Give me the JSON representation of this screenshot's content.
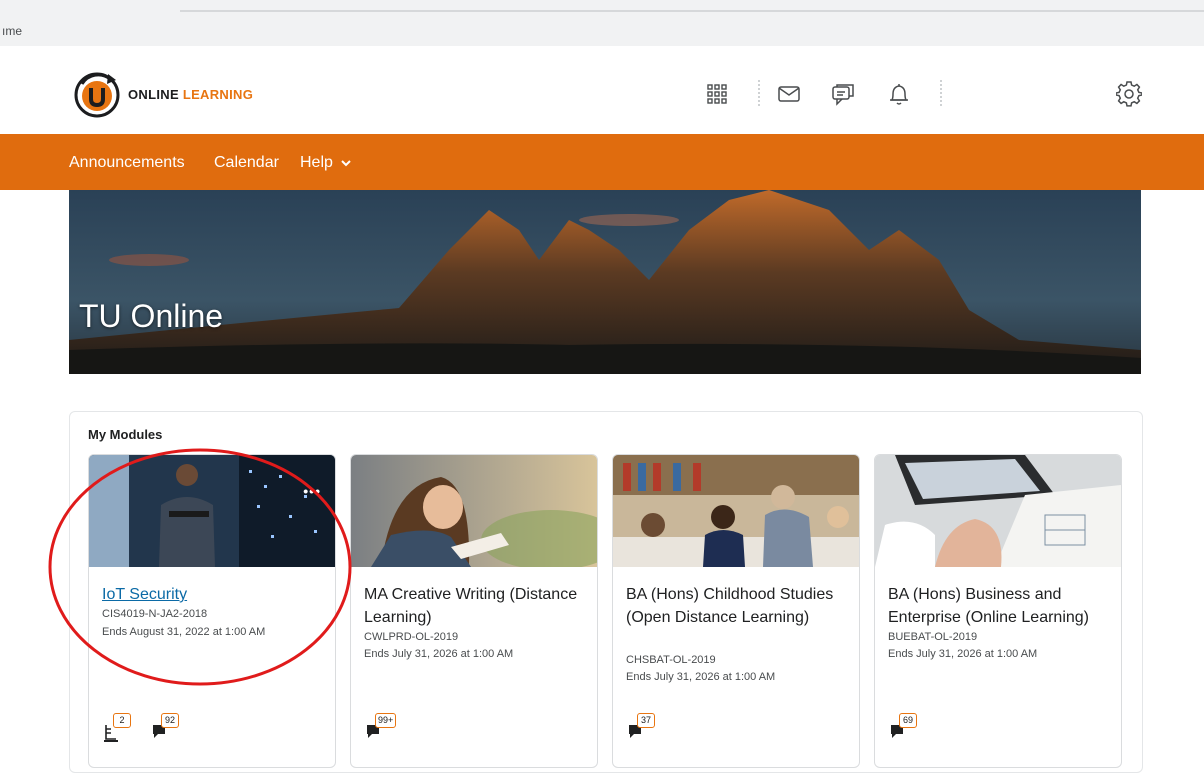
{
  "browser": {
    "partial_tab_text": "ıme"
  },
  "header": {
    "brand_part1": "ONLINE",
    "brand_part2": "LEARNING",
    "icons": [
      "apps-grid-icon",
      "mail-icon",
      "chat-icon",
      "bell-icon",
      "gear-icon"
    ]
  },
  "nav": {
    "items": [
      "Announcements",
      "Calendar",
      "Help"
    ]
  },
  "hero": {
    "title": "TU Online"
  },
  "modules": {
    "title": "My Modules",
    "cards": [
      {
        "title": "IoT Security",
        "code": "CIS4019-N-JA2-2018",
        "ends": "Ends August 31, 2022 at 1:00 AM",
        "badges": [
          "2",
          "92"
        ]
      },
      {
        "title": "MA Creative Writing (Distance Learning)",
        "code": "CWLPRD-OL-2019",
        "ends": "Ends July 31, 2026 at 1:00 AM",
        "badges": [
          "99+"
        ]
      },
      {
        "title": "BA (Hons) Childhood Studies (Open Distance Learning)",
        "code": "CHSBAT-OL-2019",
        "ends": "Ends July 31, 2026 at 1:00 AM",
        "badges": [
          "37"
        ]
      },
      {
        "title": "BA (Hons) Business and Enterprise (Online Learning)",
        "code": "BUEBAT-OL-2019",
        "ends": "Ends July 31, 2026 at 1:00 AM",
        "badges": [
          "69"
        ]
      }
    ]
  },
  "colors": {
    "accent": "#e06c0e",
    "link": "#0b6aa6",
    "annotation": "#e01b1b"
  }
}
